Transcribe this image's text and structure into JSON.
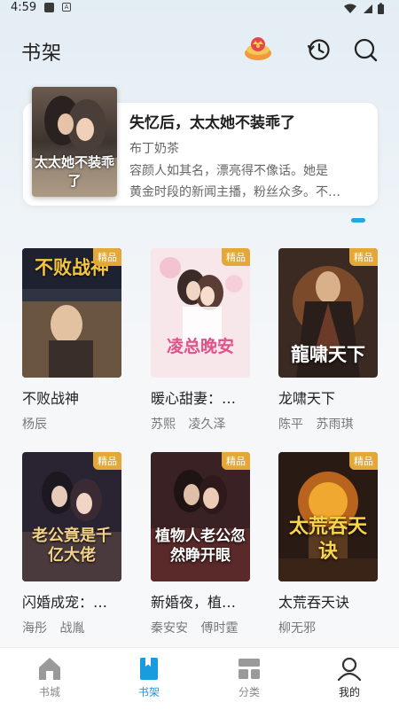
{
  "status_bar": {
    "time": "4:59"
  },
  "header": {
    "title": "书架"
  },
  "featured": {
    "title": "失忆后，太太她不装乖了",
    "author": "布丁奶茶",
    "desc_line1": "容颜人如其名，漂亮得不像话。她是",
    "desc_line2": "黄金时段的新闻主播，粉丝众多。不…",
    "cover_text": "太太她不装乖了"
  },
  "books": [
    {
      "title": "不败战神",
      "authors": [
        "杨辰"
      ],
      "badge": "精品",
      "cover_text": "不败战神"
    },
    {
      "title": "暖心甜妻：…",
      "authors": [
        "苏熙",
        "凌久泽"
      ],
      "badge": "精品",
      "cover_text": "凌总晚安"
    },
    {
      "title": "龙啸天下",
      "authors": [
        "陈平",
        "苏雨琪"
      ],
      "badge": "精品",
      "cover_text": "龍啸天下"
    },
    {
      "title": "闪婚成宠：…",
      "authors": [
        "海彤",
        "战胤"
      ],
      "badge": "精品",
      "cover_text": "老公竟是千亿大佬"
    },
    {
      "title": "新婚夜，植…",
      "authors": [
        "秦安安",
        "傅时霆"
      ],
      "badge": "精品",
      "cover_text": "植物人老公忽然睁开眼"
    },
    {
      "title": "太荒吞天诀",
      "authors": [
        "柳无邪"
      ],
      "badge": "精品",
      "cover_text": "太荒吞天诀"
    }
  ],
  "tabs": [
    {
      "label": "书城"
    },
    {
      "label": "书架"
    },
    {
      "label": "分类"
    },
    {
      "label": "我的"
    }
  ],
  "colors": {
    "accent": "#1b9ae0",
    "badge": "#e4a73a"
  }
}
